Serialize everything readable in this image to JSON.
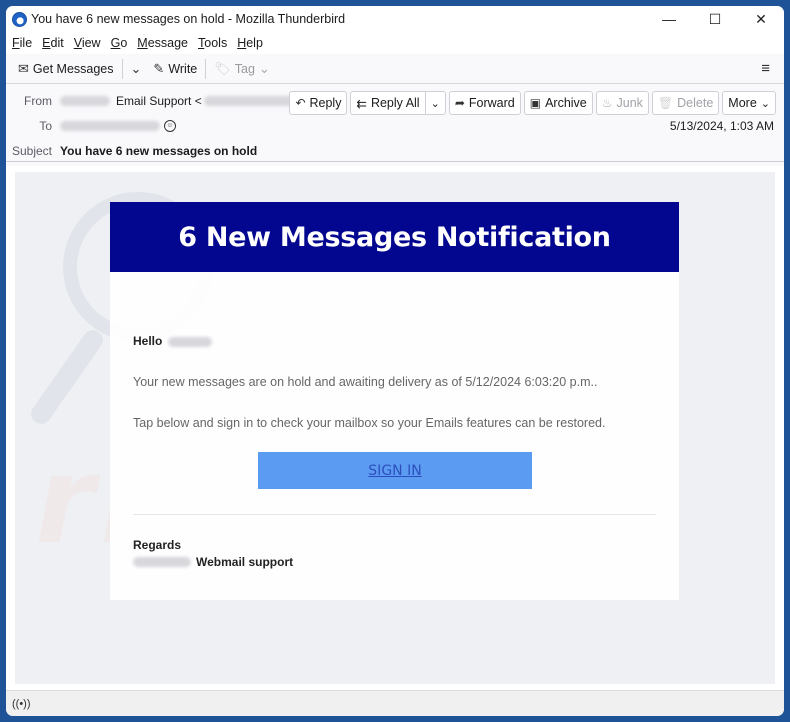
{
  "window": {
    "title": "You have 6 new messages on hold - Mozilla Thunderbird",
    "controls": {
      "minimize": "—",
      "maximize": "☐",
      "close": "✕"
    }
  },
  "menubar": {
    "items": [
      {
        "accel": "F",
        "rest": "ile"
      },
      {
        "accel": "E",
        "rest": "dit"
      },
      {
        "accel": "V",
        "rest": "iew"
      },
      {
        "accel": "G",
        "rest": "o"
      },
      {
        "accel": "M",
        "rest": "essage"
      },
      {
        "accel": "T",
        "rest": "ools"
      },
      {
        "accel": "H",
        "rest": "elp"
      }
    ]
  },
  "toolbar": {
    "get_messages": "Get Messages",
    "write": "Write",
    "tag": "Tag",
    "icons": {
      "get_messages": "✉",
      "dropdown": "⌄",
      "write": "✎",
      "tag": "🏷",
      "menu": "≡"
    }
  },
  "header": {
    "from_label": "From",
    "from_name": "Email Support <",
    "from_close": ">",
    "to_label": "To",
    "subject_label": "Subject",
    "subject": "You have 6 new messages on hold",
    "date": "5/13/2024, 1:03 AM",
    "actions": {
      "reply": "Reply",
      "reply_all": "Reply All",
      "forward": "Forward",
      "archive": "Archive",
      "junk": "Junk",
      "delete": "Delete",
      "more": "More"
    },
    "action_icons": {
      "reply": "↶",
      "reply_all": "⇇",
      "forward": "➦",
      "archive": "▣",
      "junk": "♨",
      "delete": "🗑",
      "dropdown": "⌄",
      "contact": "☺"
    }
  },
  "email": {
    "banner": "6 New Messages Notification",
    "greeting": "Hello",
    "paragraph1": "Your new messages are on hold and awaiting delivery as of 5/12/2024 6:03:20 p.m..",
    "paragraph2": "Tap below and sign in to check your mailbox so your Emails features can be restored.",
    "signin": "SIGN IN",
    "regards": "Regards",
    "signature": "Webmail support",
    "colors": {
      "banner_bg": "#03068f",
      "button_bg": "#5b9bf1",
      "button_text": "#2d4fbd"
    }
  },
  "watermark": {
    "text": "risk.com"
  },
  "statusbar": {
    "icon": "((•))"
  }
}
